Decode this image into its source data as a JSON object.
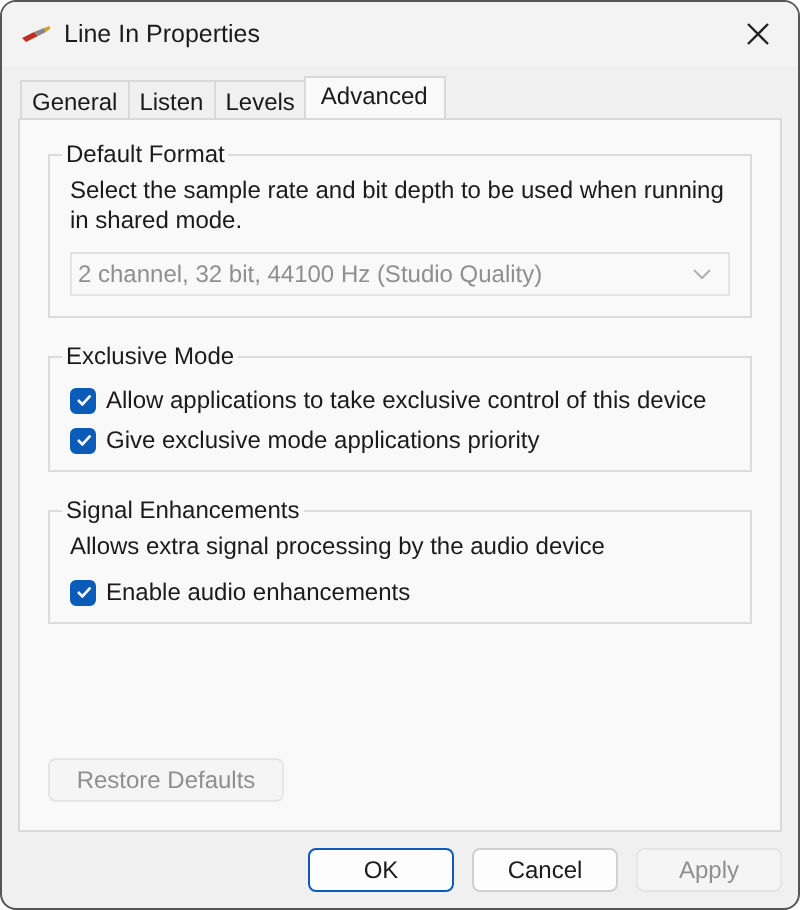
{
  "window": {
    "title": "Line In Properties"
  },
  "tabs": [
    {
      "label": "General",
      "selected": false
    },
    {
      "label": "Listen",
      "selected": false
    },
    {
      "label": "Levels",
      "selected": false
    },
    {
      "label": "Advanced",
      "selected": true
    }
  ],
  "groups": [
    {
      "title": "Default Format",
      "description": "Select the sample rate and bit depth to be used when running in shared mode.",
      "dropdown": {
        "value": "2 channel, 32 bit, 44100 Hz (Studio Quality)",
        "disabled": true
      }
    },
    {
      "title": "Exclusive Mode",
      "options": [
        {
          "label": "Allow applications to take exclusive control of this device",
          "checked": true
        },
        {
          "label": "Give exclusive mode applications priority",
          "checked": true
        }
      ]
    },
    {
      "title": "Signal Enhancements",
      "description": "Allows extra signal processing by the audio device",
      "options": [
        {
          "label": "Enable audio enhancements",
          "checked": true
        }
      ]
    }
  ],
  "restore_button": {
    "label": "Restore Defaults",
    "disabled": true
  },
  "buttons": [
    {
      "label": "OK",
      "default": true,
      "disabled": false
    },
    {
      "label": "Cancel",
      "default": false,
      "disabled": false
    },
    {
      "label": "Apply",
      "default": false,
      "disabled": true
    }
  ]
}
